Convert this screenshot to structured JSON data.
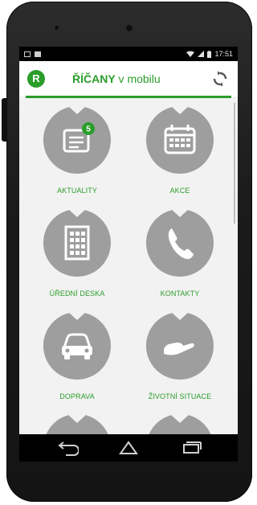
{
  "status_bar": {
    "time": "17:51"
  },
  "app_bar": {
    "logo_letter": "R",
    "title_bold": "ŘÍČANY",
    "title_rest": " v mobilu"
  },
  "menu": {
    "items": [
      {
        "label": "AKTUALITY",
        "icon": "news-icon",
        "badge": "5"
      },
      {
        "label": "AKCE",
        "icon": "calendar-icon"
      },
      {
        "label": "ÚŘEDNÍ DESKA",
        "icon": "building-icon"
      },
      {
        "label": "KONTAKTY",
        "icon": "phone-icon"
      },
      {
        "label": "DOPRAVA",
        "icon": "car-icon"
      },
      {
        "label": "ŽIVOTNÍ SITUACE",
        "icon": "hand-icon"
      }
    ]
  },
  "colors": {
    "accent": "#2a9d2a",
    "circle": "#9e9e9e",
    "background": "#f2f2f2"
  },
  "nav": {
    "back": "back-icon",
    "home": "home-icon",
    "recents": "recents-icon"
  }
}
